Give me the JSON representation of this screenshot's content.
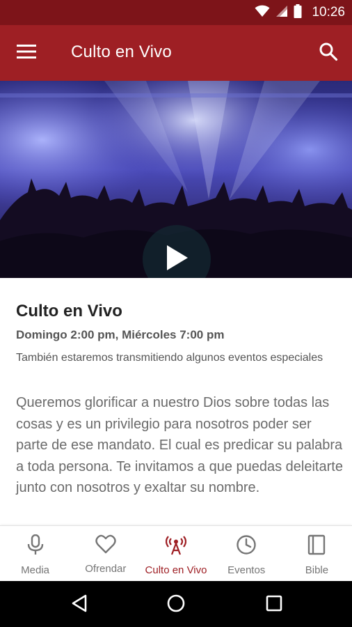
{
  "status_bar": {
    "time": "10:26",
    "icons": [
      "wifi-icon",
      "cell-signal-icon",
      "battery-icon"
    ]
  },
  "app_bar": {
    "title": "Culto en Vivo",
    "icons": [
      "menu-icon",
      "search-icon"
    ]
  },
  "hero": {
    "icon": "play-icon"
  },
  "event": {
    "title": "Culto en Vivo",
    "schedule": "Domingo 2:00 pm, Miércoles 7:00 pm",
    "summary": "También estaremos transmitiendo algunos eventos especiales",
    "description": "Queremos glorificar a nuestro Dios sobre todas las cosas y es un privilegio para nosotros poder ser parte de ese mandato. El cual es predicar su palabra a toda persona. Te invitamos a que puedas deleitarte junto con nosotros y exaltar su nombre."
  },
  "bottom_nav": {
    "items": [
      {
        "label": "Media",
        "icon": "microphone-icon",
        "active": false
      },
      {
        "label": "Ofrendar",
        "icon": "heart-icon",
        "active": false
      },
      {
        "label": "Culto en Vivo",
        "icon": "broadcast-tower-icon",
        "active": true
      },
      {
        "label": "Eventos",
        "icon": "clock-icon",
        "active": false
      },
      {
        "label": "Bible",
        "icon": "book-icon",
        "active": false
      }
    ]
  },
  "system_nav": {
    "icons": [
      "back-icon",
      "home-icon",
      "recents-icon"
    ]
  },
  "colors": {
    "app_bar": "#9e1f24",
    "status_bar": "#7d1419",
    "active_nav": "#9e1f24",
    "inactive_nav": "#757575"
  }
}
